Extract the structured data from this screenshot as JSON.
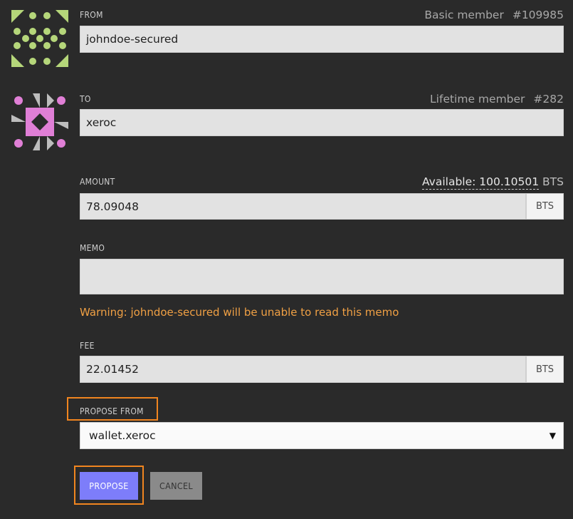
{
  "from": {
    "label": "FROM",
    "member_type": "Basic member",
    "member_id": "#109985",
    "value": "johndoe-secured"
  },
  "to": {
    "label": "TO",
    "member_type": "Lifetime member",
    "member_id": "#282",
    "value": "xeroc"
  },
  "amount": {
    "label": "AMOUNT",
    "available_label": "Available: 100.10501",
    "available_unit": "BTS",
    "value": "78.09048",
    "unit": "BTS"
  },
  "memo": {
    "label": "MEMO",
    "value": "",
    "warning": "Warning: johndoe-secured will be unable to read this memo"
  },
  "fee": {
    "label": "FEE",
    "value": "22.01452",
    "unit": "BTS"
  },
  "propose_from": {
    "label": "PROPOSE FROM",
    "selected": "wallet.xeroc",
    "caret": "▼"
  },
  "buttons": {
    "propose": "PROPOSE",
    "cancel": "CANCEL"
  },
  "colors": {
    "highlight": "#f1851f",
    "warning": "#f0a044",
    "primary_button": "#7d7dfa",
    "from_avatar": "#b5d67a",
    "to_avatar": "#e07fd6"
  }
}
